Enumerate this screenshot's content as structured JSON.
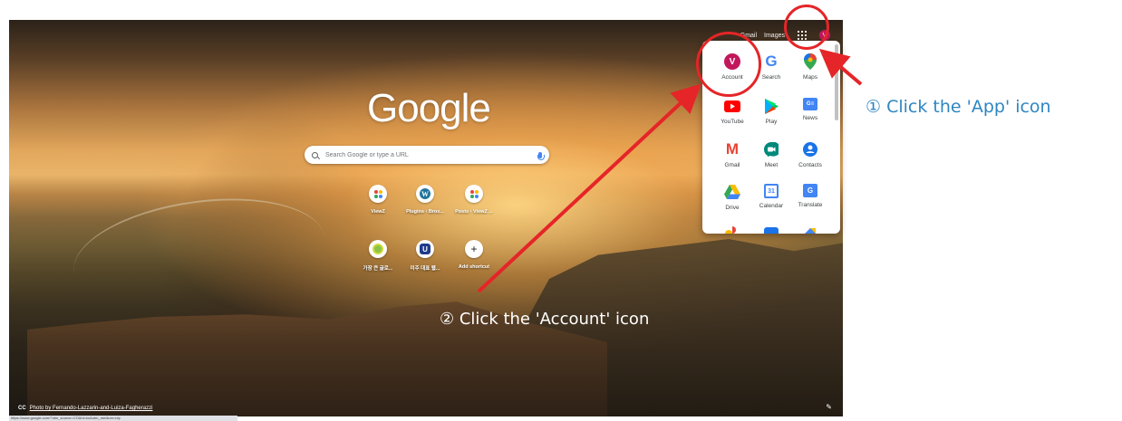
{
  "top_bar": {
    "gmail": "Gmail",
    "images": "Images",
    "avatar_letter": "V"
  },
  "logo": "Google",
  "search": {
    "placeholder": "Search Google or type a URL"
  },
  "shortcuts": [
    {
      "label": "ViewZ",
      "icon": "viewz-icon"
    },
    {
      "label": "Plugins ‹ Brox...",
      "icon": "wordpress-icon"
    },
    {
      "label": "Posts ‹ ViewZ ...",
      "icon": "viewz-icon"
    },
    {
      "label": "가장 큰 글로...",
      "icon": "green-circle-icon"
    },
    {
      "label": "미주 대표 웹...",
      "icon": "u-logo-icon"
    },
    {
      "label": "Add shortcut",
      "icon": "plus-icon"
    }
  ],
  "photo_credit": {
    "cc": "CC",
    "text": "Photo by Fernando-Lazzarin-and-Luiza-Fagherazzi"
  },
  "status_url": "https://www.google.com/?utm_source=CO&hl=ko&utm_medium=ntp",
  "apps_panel": {
    "items": [
      {
        "label": "Account",
        "icon": "account-avatar-icon",
        "letter": "V",
        "color": "#c2185b"
      },
      {
        "label": "Search",
        "icon": "google-g-icon",
        "letter": "G",
        "color": "#4285f4"
      },
      {
        "label": "Maps",
        "icon": "maps-pin-icon",
        "color": "#34a853"
      },
      {
        "label": "YouTube",
        "icon": "youtube-icon",
        "color": "#ff0000"
      },
      {
        "label": "Play",
        "icon": "play-store-icon",
        "color": "#00c853"
      },
      {
        "label": "News",
        "icon": "news-icon",
        "letter": "G≡",
        "color": "#4285f4"
      },
      {
        "label": "Gmail",
        "icon": "gmail-icon",
        "letter": "M",
        "color": "#ea4335"
      },
      {
        "label": "Meet",
        "icon": "meet-icon",
        "color": "#00897b"
      },
      {
        "label": "Contacts",
        "icon": "contacts-icon",
        "color": "#1a73e8"
      },
      {
        "label": "Drive",
        "icon": "drive-icon",
        "color": "#fbbc04"
      },
      {
        "label": "Calendar",
        "icon": "calendar-icon",
        "letter": "31",
        "color": "#4285f4"
      },
      {
        "label": "Translate",
        "icon": "translate-icon",
        "letter": "G",
        "color": "#4285f4"
      }
    ]
  },
  "annotations": {
    "step1": "① Click the 'App' icon",
    "step2": "② Click the 'Account' icon",
    "color_red": "#e52528",
    "color_blue": "#2e86c1"
  }
}
